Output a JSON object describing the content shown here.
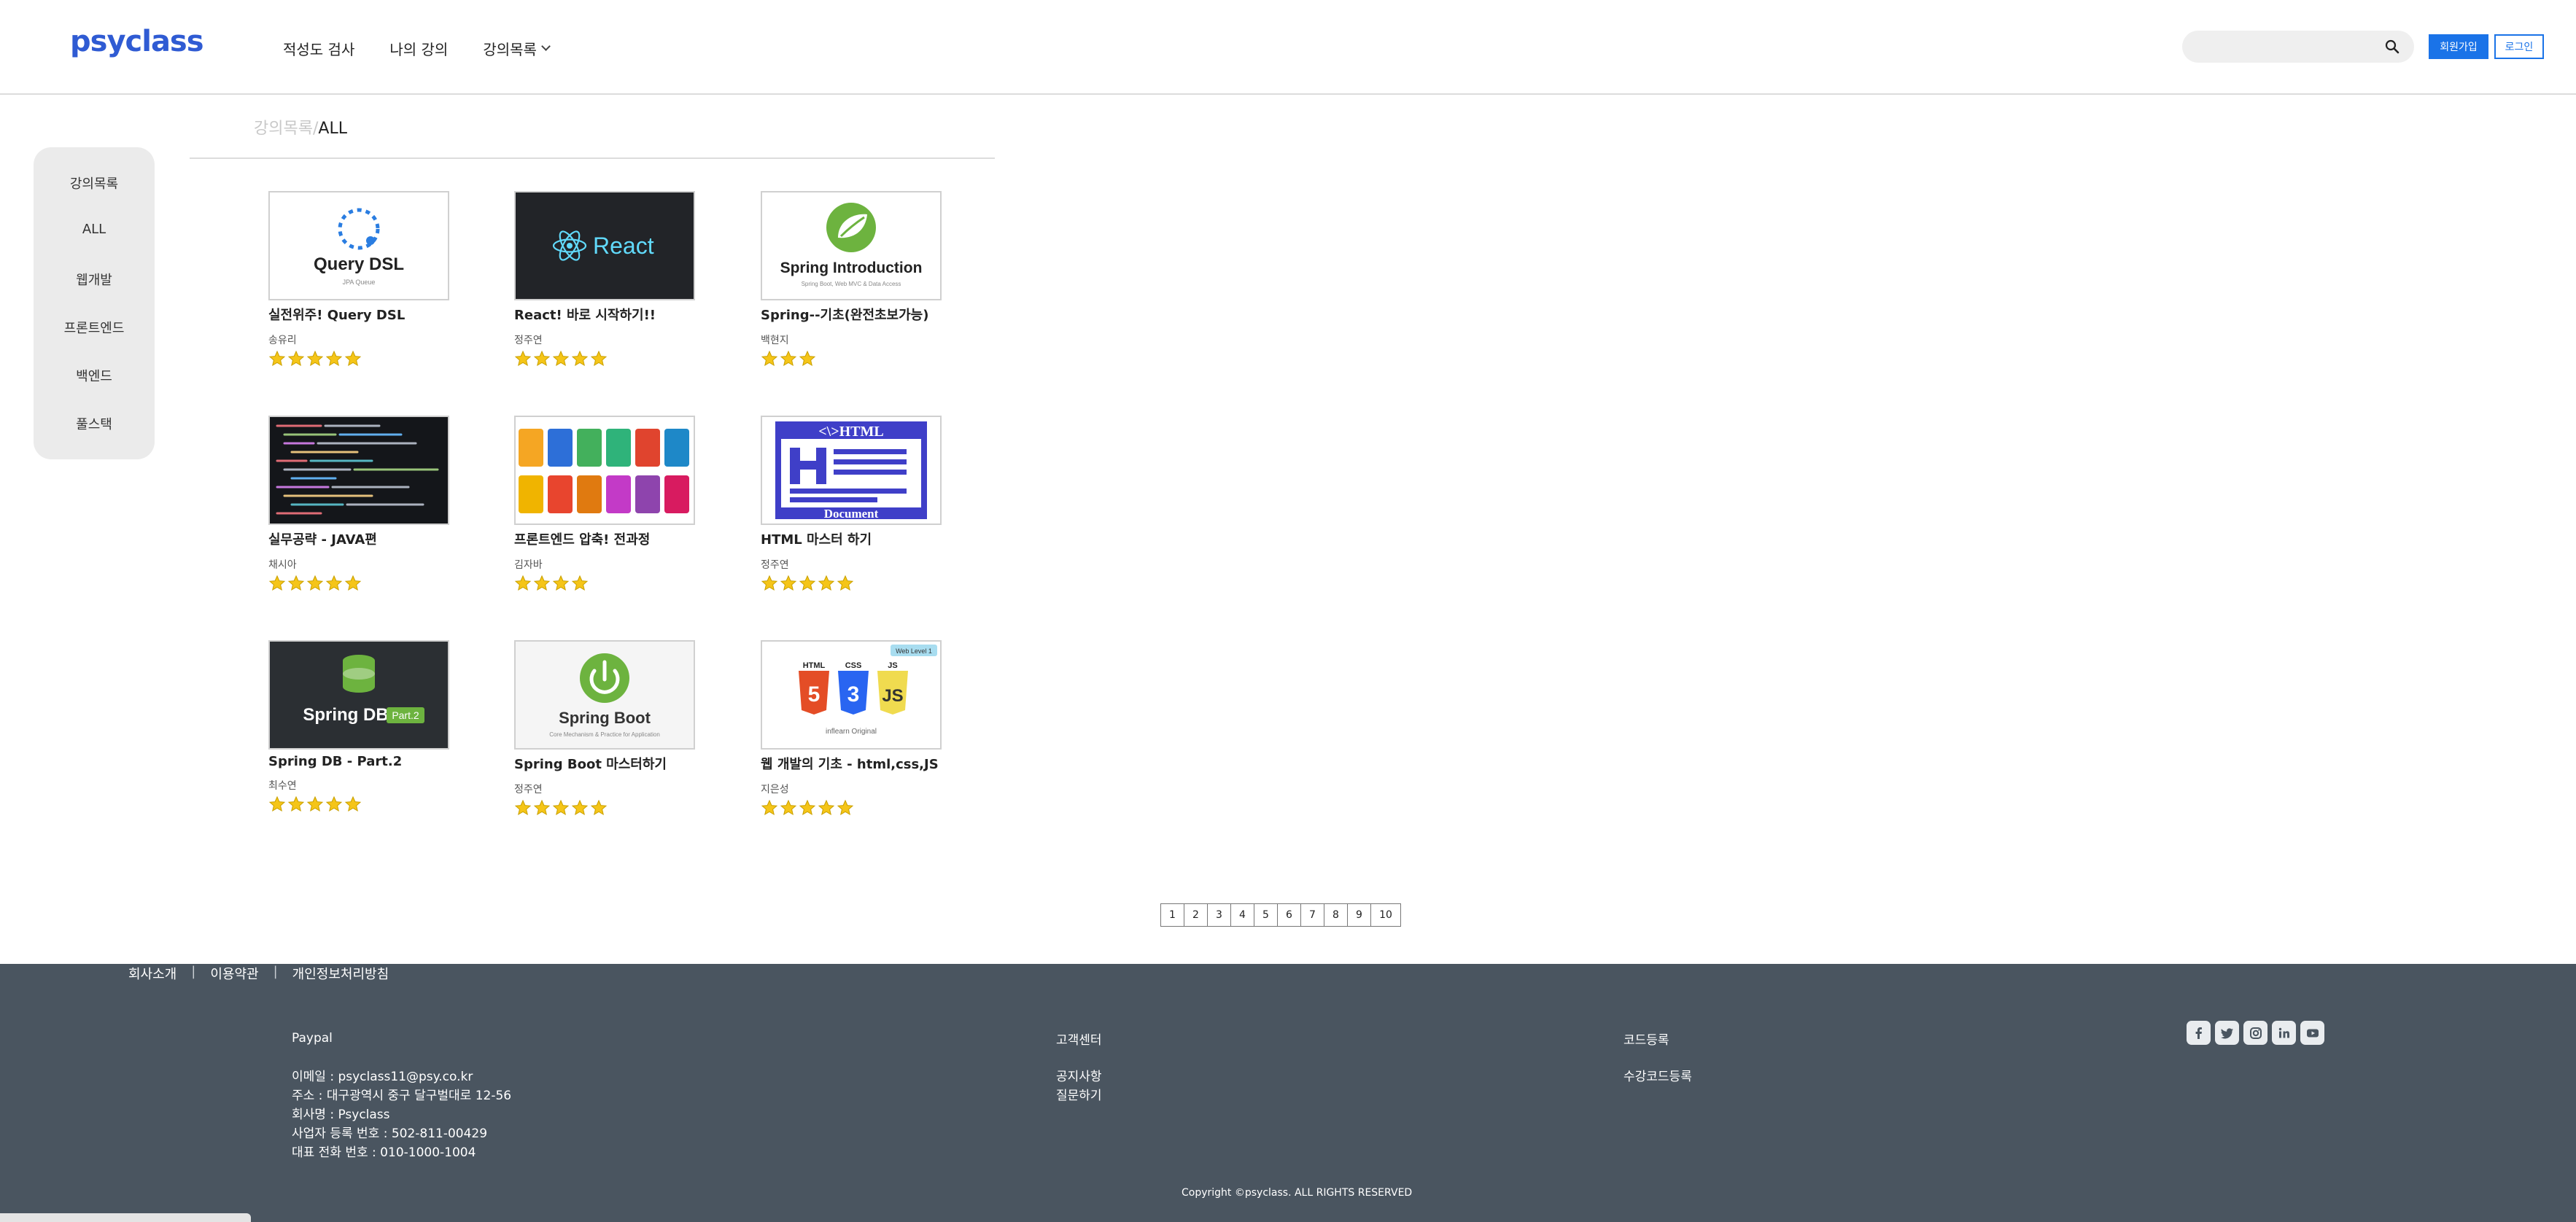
{
  "header": {
    "logo": "psyclass",
    "nav": [
      {
        "label": "적성도 검사"
      },
      {
        "label": "나의 강의"
      },
      {
        "label": "강의목록"
      }
    ],
    "search_placeholder": "",
    "signup_label": "회원가입",
    "login_label": "로그인"
  },
  "sidebar": {
    "items": [
      {
        "label": "강의목록"
      },
      {
        "label": "ALL"
      },
      {
        "label": "웹개발"
      },
      {
        "label": "프론트엔드"
      },
      {
        "label": "백엔드"
      },
      {
        "label": "풀스택"
      }
    ]
  },
  "breadcrumb": {
    "root": "강의목록",
    "separator": "/",
    "current": "ALL"
  },
  "courses": [
    {
      "title": "실전위주! Query DSL",
      "author": "송유리",
      "rating": 5,
      "thumb_text": "Query DSL",
      "thumb_sub": "JPA Queue"
    },
    {
      "title": "React! 바로 시작하기!!",
      "author": "정주연",
      "rating": 5,
      "thumb_text": "React"
    },
    {
      "title": "Spring--기초(완전초보가능)",
      "author": "백현지",
      "rating": 3,
      "thumb_text": "Spring Introduction",
      "thumb_sub": "Spring Boot, Web MVC & Data Access"
    },
    {
      "title": "실무공략 - JAVA편",
      "author": "채시아",
      "rating": 5
    },
    {
      "title": "프론트엔드 압축! 전과정",
      "author": "김자바",
      "rating": 4
    },
    {
      "title": "HTML 마스터 하기",
      "author": "정주연",
      "rating": 5,
      "thumb_text": "<\\>HTML",
      "thumb_text2": "Document"
    },
    {
      "title": "Spring DB - Part.2",
      "author": "최수연",
      "rating": 5,
      "thumb_text": "Spring DB",
      "thumb_badge": "Part.2"
    },
    {
      "title": "Spring Boot 마스터하기",
      "author": "정주연",
      "rating": 5,
      "thumb_text": "Spring Boot",
      "thumb_sub": "Core Mechanism & Practice for Application"
    },
    {
      "title": "웹 개발의 기초 - html,css,JS",
      "author": "지은성",
      "rating": 5,
      "thumb_badge": "Web Level 1",
      "thumb_sub": "inflearn Original"
    }
  ],
  "pagination": [
    "1",
    "2",
    "3",
    "4",
    "5",
    "6",
    "7",
    "8",
    "9",
    "10"
  ],
  "footer": {
    "links": [
      "회사소개",
      "이용약관",
      "개인정보처리방침"
    ],
    "company_title": "Paypal",
    "info": [
      "이메일 : psyclass11@psy.co.kr",
      "주소 : 대구광역시 중구 달구벌대로 12-56",
      "회사명 : Psyclass",
      "사업자 등록 번호 : 502-811-00429",
      "대표 전화 번호 : 010-1000-1004"
    ],
    "support_title": "고객센터",
    "support_links": [
      "공지사항",
      "질문하기"
    ],
    "code_title": "코드등록",
    "code_links": [
      "수강코드등록"
    ],
    "copyright": "Copyright ©psyclass. ALL RIGHTS RESERVED"
  },
  "colors": {
    "brand": "#2f5bd3",
    "primary_button": "#1a73e8",
    "footer_bg": "#4a5560",
    "star": "#f5c518"
  }
}
